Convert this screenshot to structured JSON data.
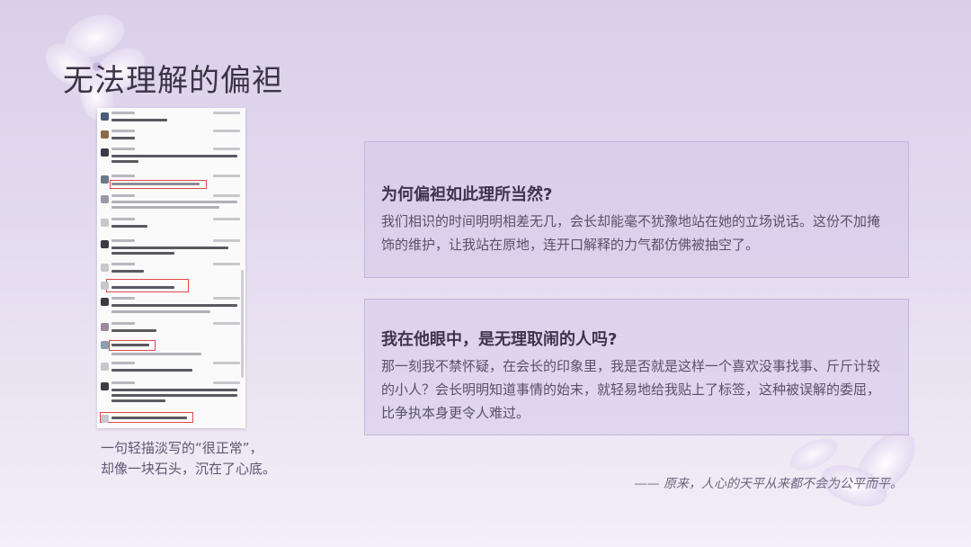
{
  "title": "无法理解的偏袒",
  "caption": {
    "line1": "一句轻描淡写的“很正常”，",
    "line2": "却像一块石头，沉在了心底。"
  },
  "cards": [
    {
      "heading": "为何偏袒如此理所当然?",
      "body": "我们相识的时间明明相差无几，会长却能毫不犹豫地站在她的立场说话。这份不加掩饰的维护，让我站在原地，连开口解释的力气都仿佛被抽空了。"
    },
    {
      "heading": "我在他眼中，是无理取闹的人吗?",
      "body": "那一刻我不禁怀疑，在会长的印象里，我是否就是这样一个喜欢没事找事、斤斤计较的小人？会长明明知道事情的始末，就轻易地给我贴上了标签，这种被误解的委屈，比争执本身更令人难过。"
    }
  ],
  "quote": "—— 原来，人心的天平从来都不会为公平而平。",
  "colors": {
    "accent": "#3f3450",
    "card_bg": "#d6c9e9",
    "highlight": "#e14848"
  }
}
